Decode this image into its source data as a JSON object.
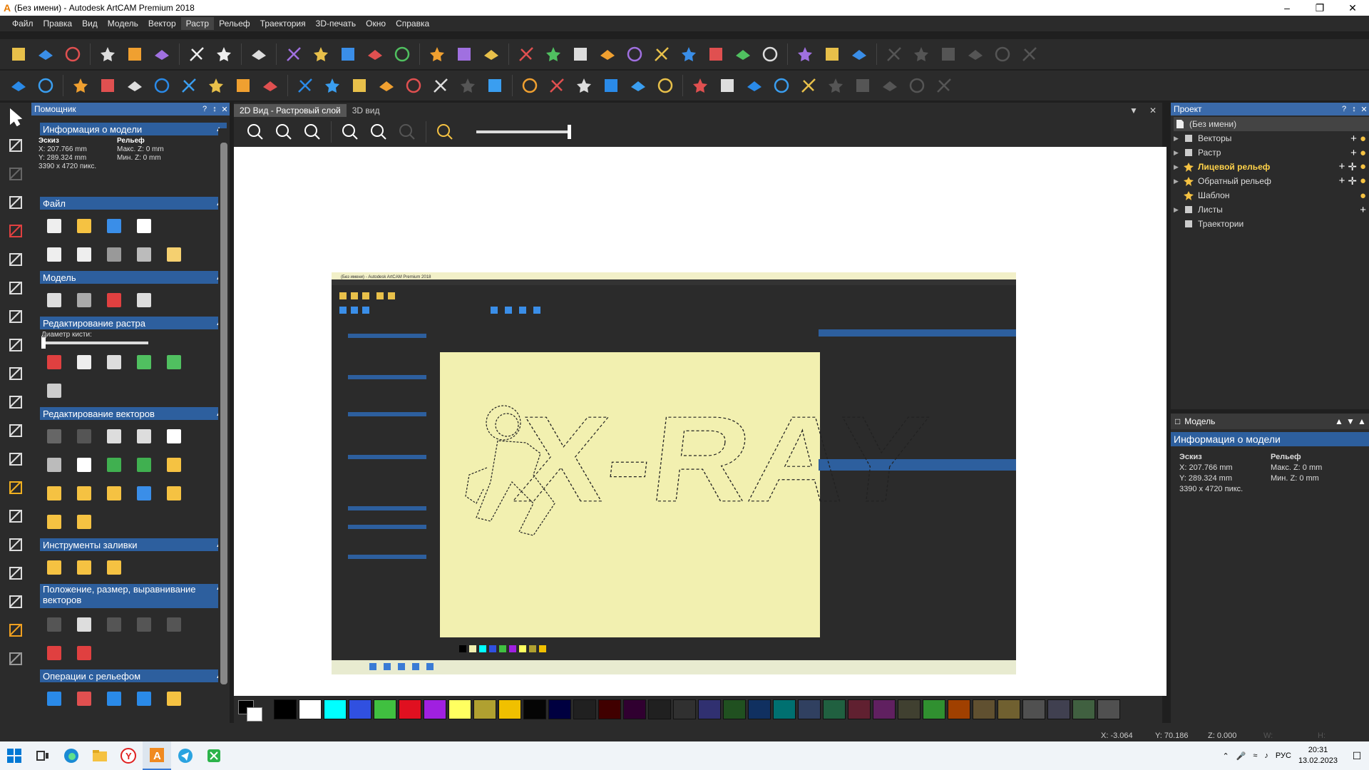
{
  "window": {
    "title": "(Без имени) - Autodesk ArtCAM Premium 2018",
    "min_icon": "minimize-icon",
    "max_icon": "maximize-icon",
    "close_icon": "close-icon"
  },
  "menu": [
    "Файл",
    "Правка",
    "Вид",
    "Модель",
    "Вектор",
    "Растр",
    "Рельеф",
    "Траектория",
    "3D-печать",
    "Окно",
    "Справка"
  ],
  "menu_active": "Растр",
  "assistant": {
    "title": "Помощник",
    "sections": {
      "model_info": "Информация о модели",
      "file": "Файл",
      "model": "Модель",
      "raster_edit": "Редактирование растра",
      "brush_label": "Диаметр кисти:",
      "vector_edit": "Редактирование векторов",
      "fill_tools": "Инструменты заливки",
      "vector_pos": "Положение, размер, выравнивание векторов",
      "relief_ops": "Операции с рельефом"
    },
    "info": {
      "sketch_label": "Эскиз",
      "relief_label": "Рельеф",
      "x": "X: 207.766 mm",
      "y": "Y: 289.324 mm",
      "size": "3390 x 4720 пикс.",
      "max_z": "Макс. Z: 0 mm",
      "min_z": "Мин. Z: 0 mm"
    }
  },
  "tabs": [
    "2D Вид - Растровый слой",
    "3D вид"
  ],
  "project": {
    "title": "Проект",
    "root": "(Без имени)",
    "items": [
      {
        "label": "Векторы",
        "icon": "vectors-icon",
        "highlight": false
      },
      {
        "label": "Растр",
        "icon": "raster-icon",
        "highlight": false
      },
      {
        "label": "Лицевой рельеф",
        "icon": "star-icon",
        "highlight": true
      },
      {
        "label": "Обратный рельеф",
        "icon": "star-icon",
        "highlight": false
      },
      {
        "label": "Шаблон",
        "icon": "star-icon",
        "highlight": false
      },
      {
        "label": "Листы",
        "icon": "sheets-icon",
        "highlight": false
      },
      {
        "label": "Траектории",
        "icon": "toolpath-icon",
        "highlight": false
      }
    ]
  },
  "model_panel": {
    "title": "Модель",
    "info_title": "Информация о модели",
    "sketch_label": "Эскиз",
    "relief_label": "Рельеф",
    "x": "X: 207.766 mm",
    "y": "Y: 289.324 mm",
    "size": "3390 x 4720 пикс.",
    "max_z": "Макс. Z: 0 mm",
    "min_z": "Мин. Z: 0 mm"
  },
  "status": {
    "x": "X: -3.064",
    "y": "Y: 70.186",
    "z": "Z: 0.000",
    "w": "W:",
    "h": "H:"
  },
  "canvas_image": {
    "text": "X-RAY",
    "title": "(Без имени) - Autodesk ArtCAM Premium 2018"
  },
  "palette_colors": [
    "#000000",
    "#ffffff",
    "#00ffff",
    "#3050e0",
    "#40c040",
    "#e01020",
    "#a020e0",
    "#ffff60",
    "#b0a030",
    "#f0c000",
    "#050505",
    "#000040",
    "#202020",
    "#400000",
    "#300030",
    "#202020",
    "#303030",
    "#303070",
    "#205020",
    "#103060",
    "#007070",
    "#304060",
    "#206040",
    "#602030",
    "#602060",
    "#404030",
    "#309030",
    "#a04000",
    "#605030",
    "#706030",
    "#505050",
    "#404050",
    "#406040",
    "#505050"
  ],
  "taskbar": {
    "time": "20:31",
    "date": "13.02.2023",
    "lang": "РУС"
  },
  "colors": {
    "accent": "#2d5f9e",
    "canvas_bg": "#f2f0b0",
    "highlight": "#ffd24a"
  }
}
